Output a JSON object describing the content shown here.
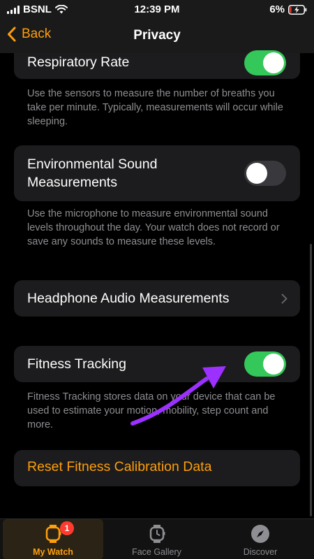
{
  "status_bar": {
    "carrier": "BSNL",
    "time": "12:39 PM",
    "battery": "6%"
  },
  "nav": {
    "back_label": "Back",
    "title": "Privacy"
  },
  "rows": {
    "respiratory": {
      "label": "Respiratory Rate",
      "enabled": true,
      "description": "Use the sensors to measure the number of breaths you take per minute. Typically, measurements will occur while sleeping."
    },
    "environmental": {
      "label_line1": "Environmental Sound",
      "label_line2": "Measurements",
      "enabled": false,
      "description": "Use the microphone to measure environmental sound levels throughout the day. Your watch does not record or save any sounds to measure these levels."
    },
    "headphone": {
      "label": "Headphone Audio Measurements"
    },
    "fitness": {
      "label": "Fitness Tracking",
      "enabled": true,
      "description": "Fitness Tracking stores data on your device that can be used to estimate your motion, mobility, step count and more."
    },
    "reset": {
      "label": "Reset Fitness Calibration Data"
    }
  },
  "tabs": [
    {
      "label": "My Watch",
      "icon": "watch-icon",
      "active": true,
      "badge": "1"
    },
    {
      "label": "Face Gallery",
      "icon": "watch-face-icon",
      "active": false
    },
    {
      "label": "Discover",
      "icon": "compass-icon",
      "active": false
    }
  ],
  "colors": {
    "accent": "#ff9f0a",
    "toggle_on": "#34c759",
    "annotation_arrow": "#9b30ff"
  }
}
